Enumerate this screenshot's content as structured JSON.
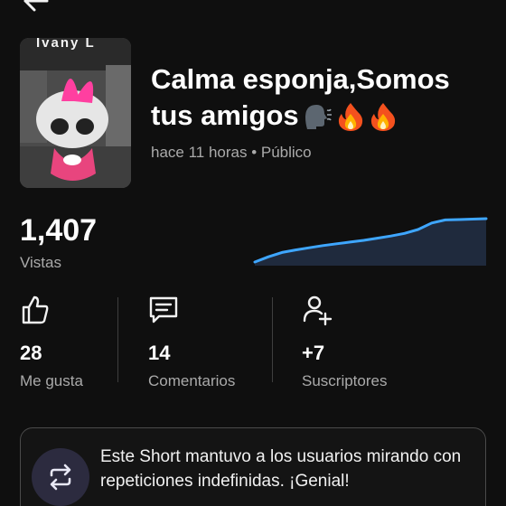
{
  "video": {
    "thumbnail_caption": "Ivany L",
    "title": "Calma esponja,Somos tus amigos",
    "title_emojis": [
      "speaking-head-emoji",
      "fire-emoji",
      "fire-emoji"
    ],
    "meta": "hace 11 horas • Público"
  },
  "views": {
    "count": "1,407",
    "label": "Vistas",
    "trend": [
      0.0,
      0.12,
      0.22,
      0.28,
      0.33,
      0.38,
      0.42,
      0.46,
      0.5,
      0.55,
      0.6,
      0.66,
      0.75,
      0.9,
      0.97,
      0.98,
      0.99,
      1.0
    ],
    "line_color": "#3ea6ff",
    "fill_color": "#1f2a3d"
  },
  "stats": [
    {
      "icon": "thumbs-up-icon",
      "value": "28",
      "label": "Me gusta"
    },
    {
      "icon": "comment-icon",
      "value": "14",
      "label": "Comentarios"
    },
    {
      "icon": "add-person-icon",
      "value": "+7",
      "label": "Suscriptores"
    }
  ],
  "banner": {
    "icon": "repeat-icon",
    "text": "Este Short mantuvo a los usuarios mirando con repeticiones indefinidas. ¡Genial!"
  }
}
